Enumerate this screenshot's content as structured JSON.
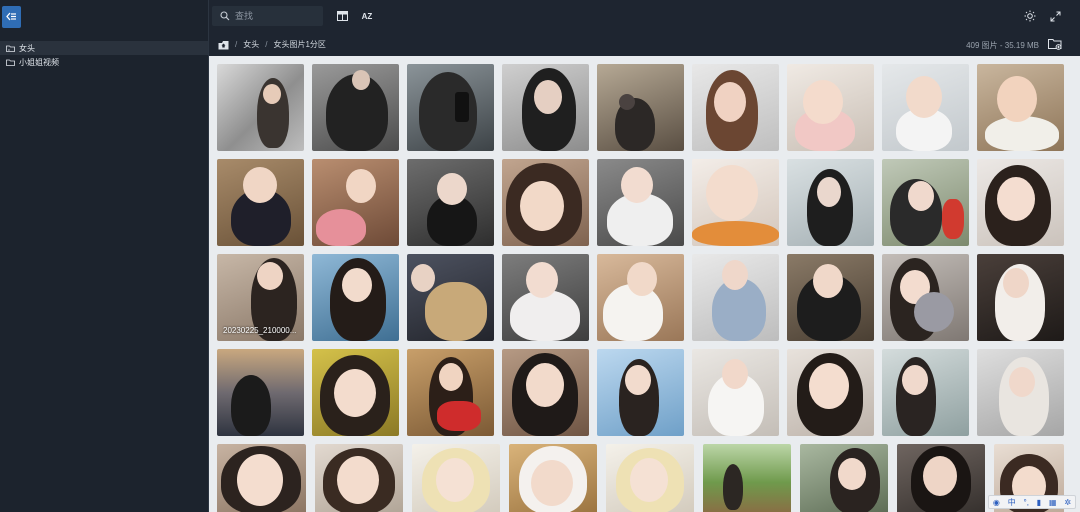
{
  "sidebar": {
    "items": [
      {
        "label": "女头"
      },
      {
        "label": "小姐姐视频"
      }
    ]
  },
  "topbar": {
    "search_placeholder": "查找",
    "sort_label": "AZ"
  },
  "breadcrumb": {
    "items": [
      "女头",
      "女头图片1分区"
    ]
  },
  "stats": {
    "text": "409 图片 - 35.19 MB"
  },
  "gallery": {
    "caption": "20230225_210000..."
  },
  "ime": {
    "mode": "中"
  },
  "colors": {
    "accent": "#2f6db5",
    "background": "#1e2530",
    "gallery_bg": "#e9ecef"
  },
  "icons": [
    "collapse-icon",
    "folder-icon",
    "search-icon",
    "layout-icon",
    "sort-az-icon",
    "brightness-icon",
    "fullscreen-icon",
    "home-icon",
    "add-folder-icon"
  ]
}
